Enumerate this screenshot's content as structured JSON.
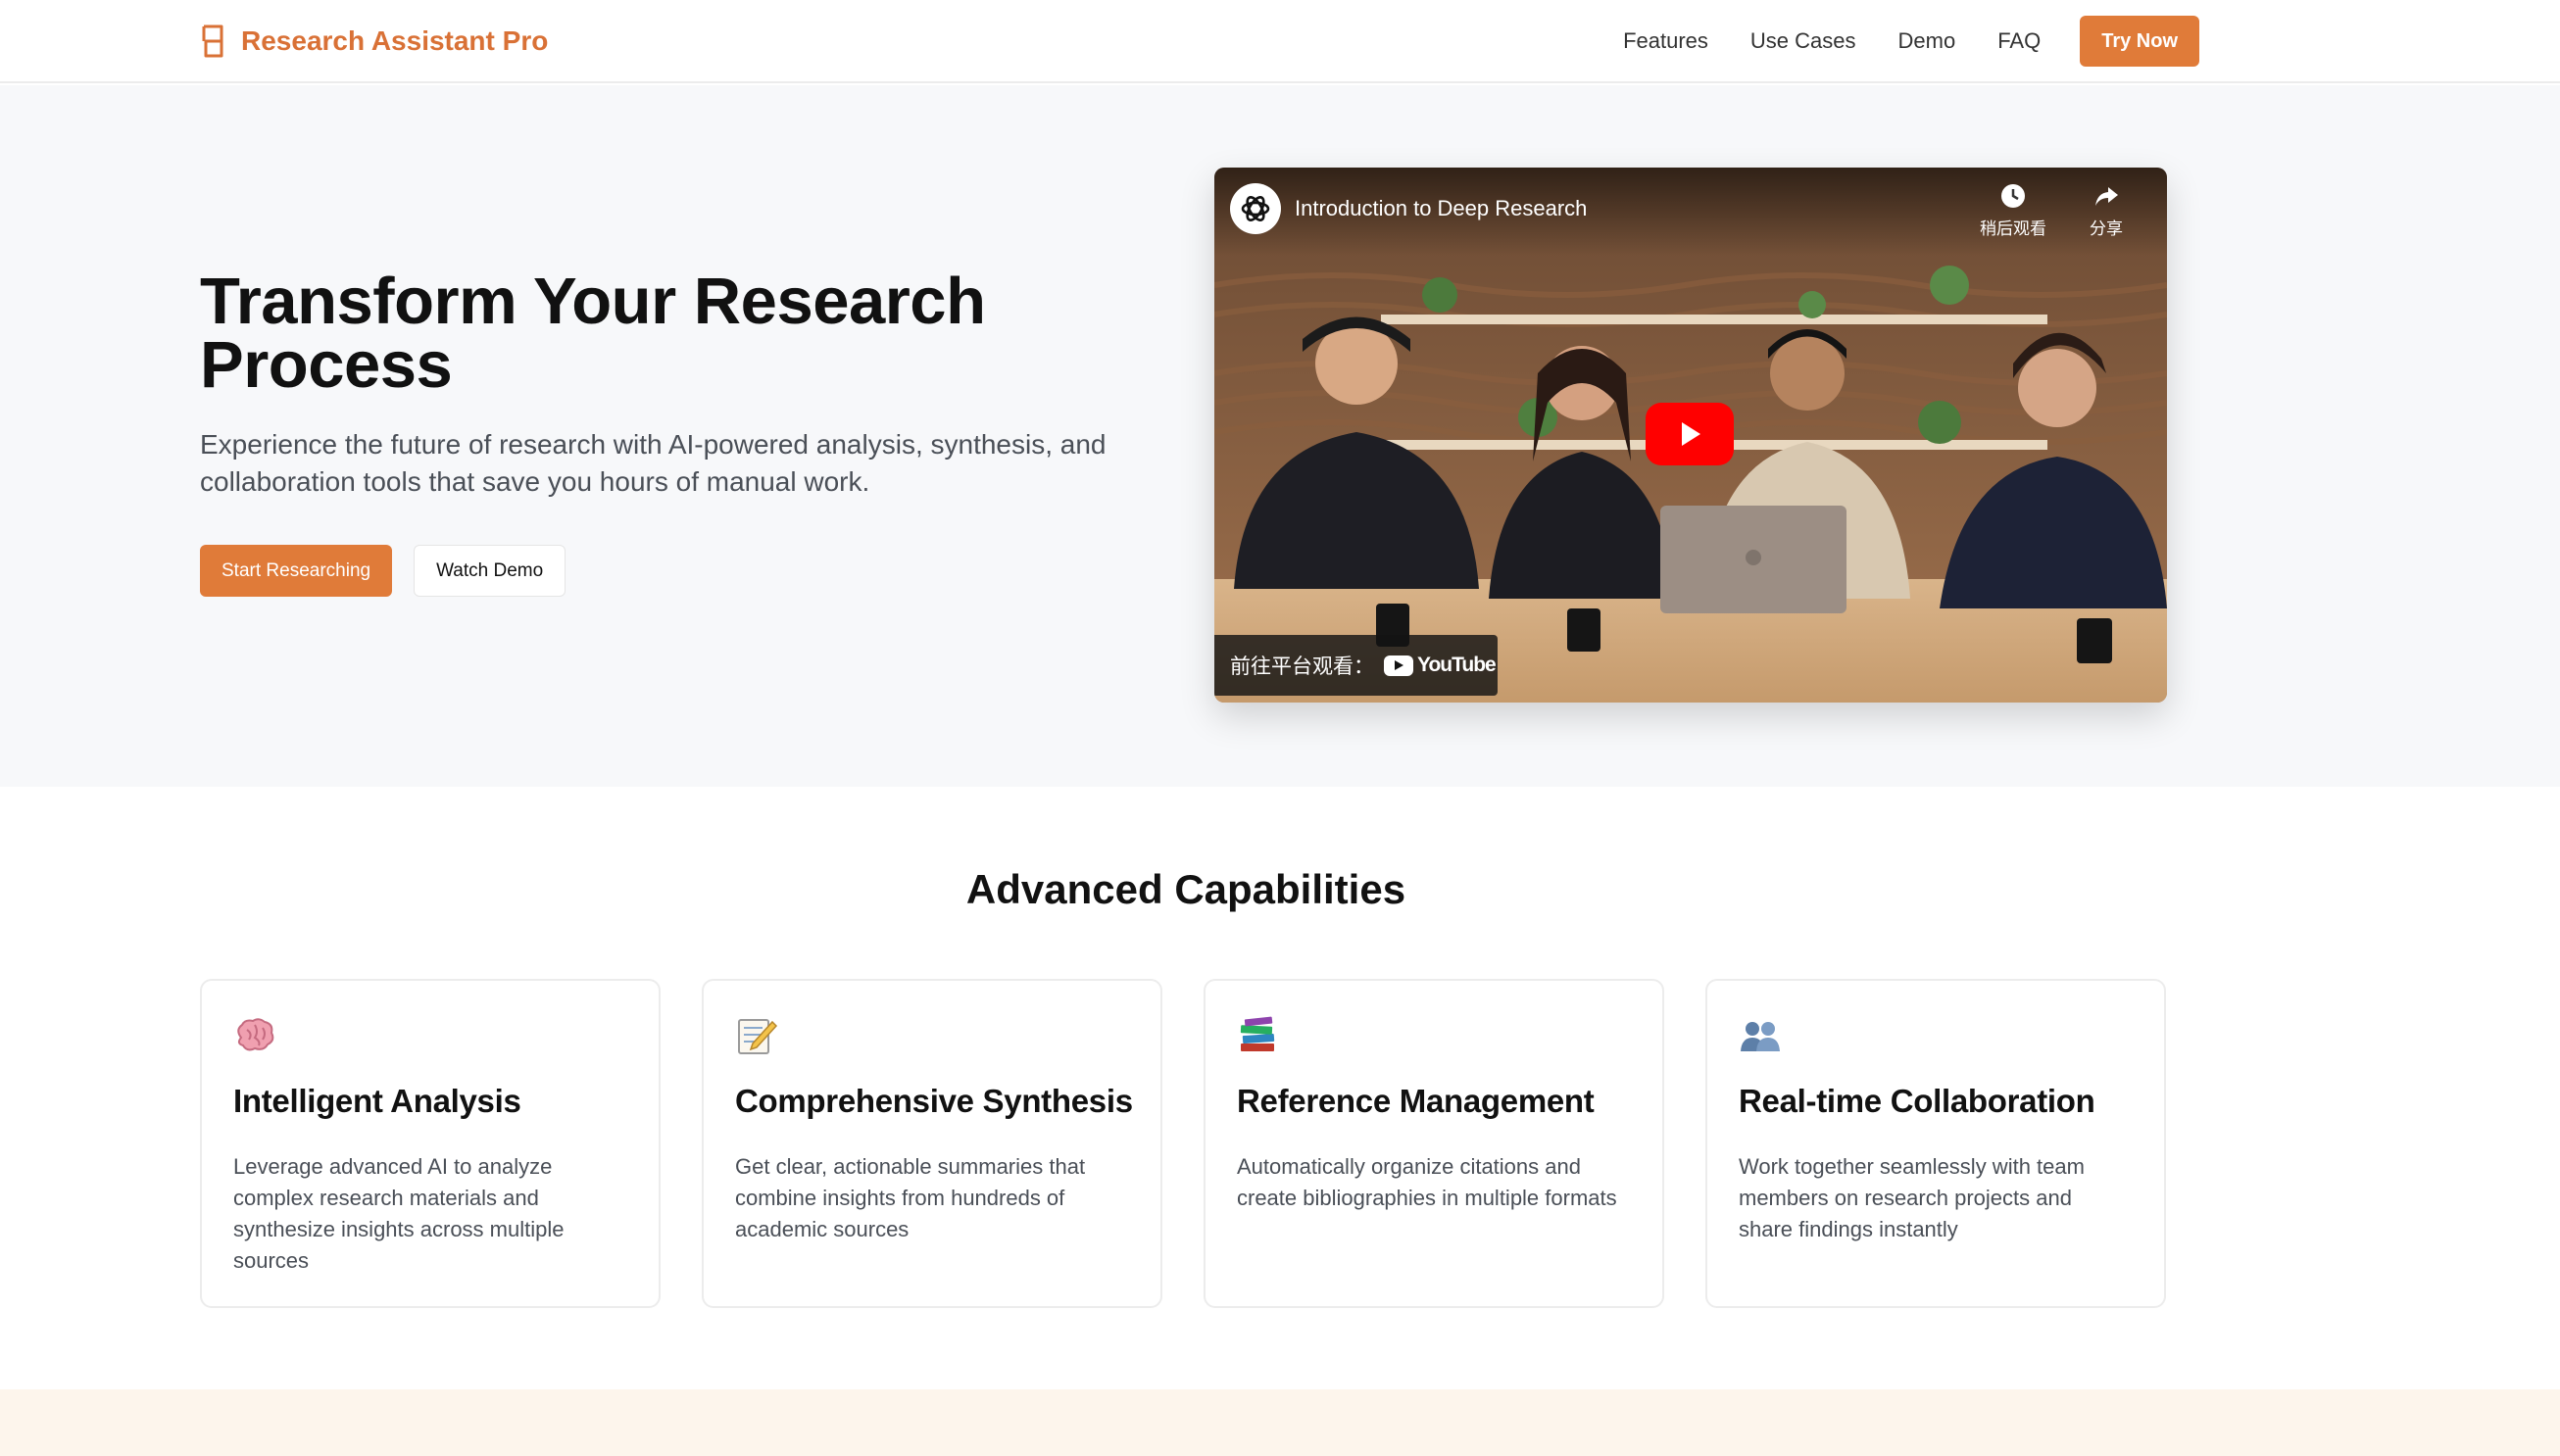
{
  "brand": {
    "name": "Research Assistant Pro",
    "color": "#d97136"
  },
  "nav": {
    "links": [
      "Features",
      "Use Cases",
      "Demo",
      "FAQ"
    ],
    "cta": "Try Now"
  },
  "hero": {
    "title": "Transform Your Research Process",
    "subtitle": "Experience the future of research with AI-powered analysis, synthesis, and collaboration tools that save you hours of manual work.",
    "primary_button": "Start Researching",
    "secondary_button": "Watch Demo"
  },
  "video": {
    "title": "Introduction to Deep Research",
    "watch_later": "稍后观看",
    "share": "分享",
    "watch_on": "前往平台观看：",
    "platform": "YouTube"
  },
  "capabilities": {
    "title": "Advanced Capabilities",
    "cards": [
      {
        "icon": "brain-icon",
        "title": "Intelligent Analysis",
        "description": "Leverage advanced AI to analyze complex research materials and synthesize insights across multiple sources"
      },
      {
        "icon": "memo-icon",
        "title": "Comprehensive Synthesis",
        "description": "Get clear, actionable summaries that combine insights from hundreds of academic sources"
      },
      {
        "icon": "books-icon",
        "title": "Reference Management",
        "description": "Automatically organize citations and create bibliographies in multiple formats"
      },
      {
        "icon": "people-icon",
        "title": "Real-time Collaboration",
        "description": "Work together seamlessly with team members on research projects and share findings instantly"
      }
    ]
  },
  "colors": {
    "accent": "#e07b39",
    "hero_bg": "#f7f8fa",
    "band_bg": "#fdf5ec"
  }
}
